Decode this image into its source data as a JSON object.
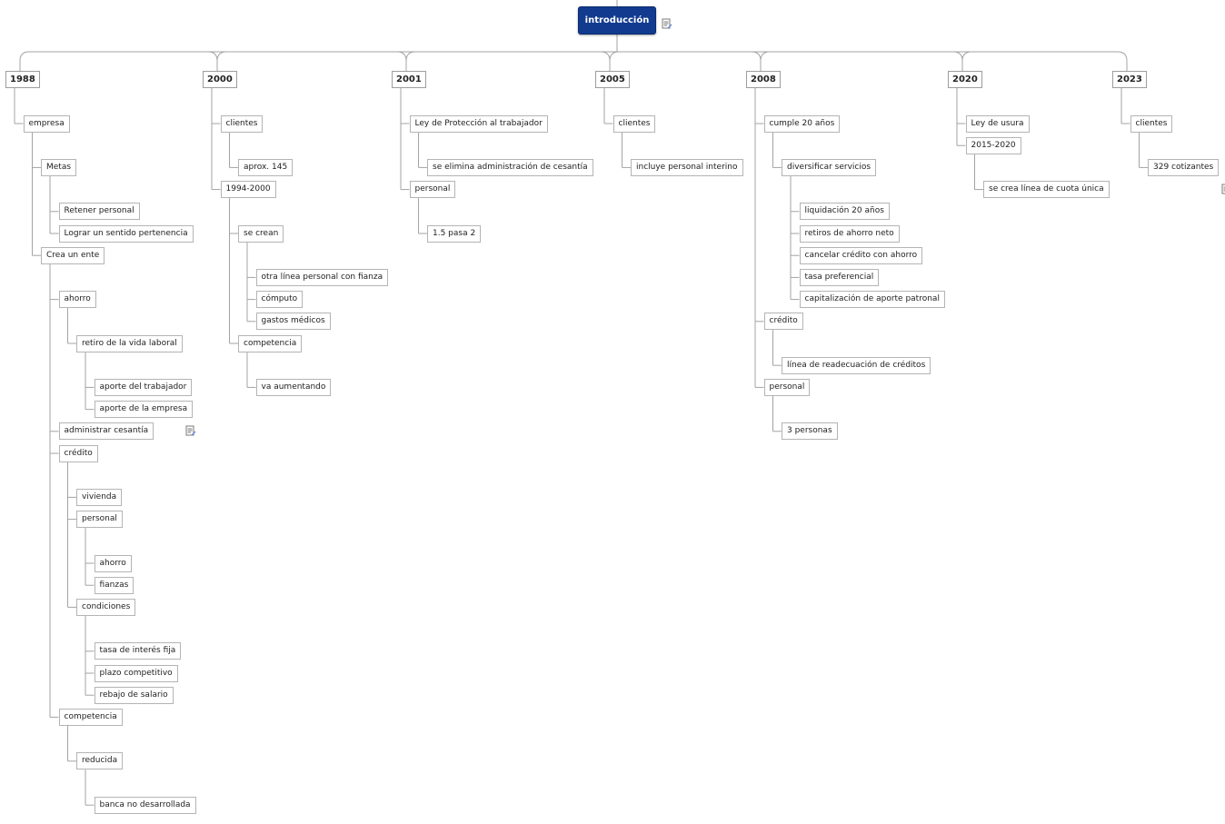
{
  "root": {
    "label": "introducción"
  },
  "icons": {
    "note": "note-icon"
  },
  "branches": [
    {
      "label": "1988",
      "children": [
        {
          "label": "empresa",
          "children": [
            {
              "label": "Metas",
              "children": [
                {
                  "label": "Retener personal"
                },
                {
                  "label": "Lograr un sentido pertenencia"
                }
              ]
            },
            {
              "label": "Crea un ente",
              "children": [
                {
                  "label": "ahorro",
                  "children": [
                    {
                      "label": "retiro de la vida laboral",
                      "note": true,
                      "children": [
                        {
                          "label": "aporte del trabajador"
                        },
                        {
                          "label": "aporte de la empresa"
                        }
                      ]
                    }
                  ]
                },
                {
                  "label": "administrar cesantía"
                },
                {
                  "label": "crédito",
                  "children": [
                    {
                      "label": "vivienda"
                    },
                    {
                      "label": "personal",
                      "children": [
                        {
                          "label": "ahorro"
                        },
                        {
                          "label": "fianzas"
                        }
                      ]
                    },
                    {
                      "label": "condiciones",
                      "children": [
                        {
                          "label": "tasa de interés fija"
                        },
                        {
                          "label": "plazo competitivo"
                        },
                        {
                          "label": "rebajo de salario"
                        }
                      ]
                    }
                  ]
                },
                {
                  "label": "competencia",
                  "children": [
                    {
                      "label": "reducida",
                      "children": [
                        {
                          "label": "banca no desarrollada"
                        }
                      ]
                    }
                  ]
                }
              ]
            }
          ]
        }
      ]
    },
    {
      "label": "2000",
      "children": [
        {
          "label": "clientes",
          "children": [
            {
              "label": "aprox. 145"
            }
          ]
        },
        {
          "label": "1994-2000",
          "children": [
            {
              "label": "se crean",
              "children": [
                {
                  "label": "otra línea personal con fianza"
                },
                {
                  "label": "cómputo"
                },
                {
                  "label": "gastos médicos"
                }
              ]
            },
            {
              "label": "competencia",
              "children": [
                {
                  "label": "va aumentando"
                }
              ]
            }
          ]
        }
      ]
    },
    {
      "label": "2001",
      "children": [
        {
          "label": "Ley de Protección al trabajador",
          "children": [
            {
              "label": "se elimina administración de cesantía"
            }
          ]
        },
        {
          "label": "personal",
          "children": [
            {
              "label": "1.5 pasa 2"
            }
          ]
        }
      ]
    },
    {
      "label": "2005",
      "children": [
        {
          "label": "clientes",
          "children": [
            {
              "label": "incluye personal interino"
            }
          ]
        }
      ]
    },
    {
      "label": "2008",
      "children": [
        {
          "label": "cumple 20 años",
          "children": [
            {
              "label": "diversificar servicios",
              "children": [
                {
                  "label": "liquidación 20 años"
                },
                {
                  "label": "retiros de ahorro neto"
                },
                {
                  "label": "cancelar crédito con ahorro"
                },
                {
                  "label": "tasa preferencial"
                },
                {
                  "label": "capitalización de aporte patronal"
                }
              ]
            }
          ]
        },
        {
          "label": "crédito",
          "children": [
            {
              "label": "línea de readecuación de créditos"
            }
          ]
        },
        {
          "label": "personal",
          "children": [
            {
              "label": "3 personas"
            }
          ]
        }
      ]
    },
    {
      "label": "2020",
      "children": [
        {
          "label": "Ley de usura"
        },
        {
          "label": "2015-2020",
          "children": [
            {
              "label": "se crea línea de cuota única"
            }
          ]
        }
      ]
    },
    {
      "label": "2023",
      "children": [
        {
          "label": "clientes",
          "children": [
            {
              "label": "329 cotizantes",
              "note": true
            }
          ]
        }
      ]
    }
  ]
}
